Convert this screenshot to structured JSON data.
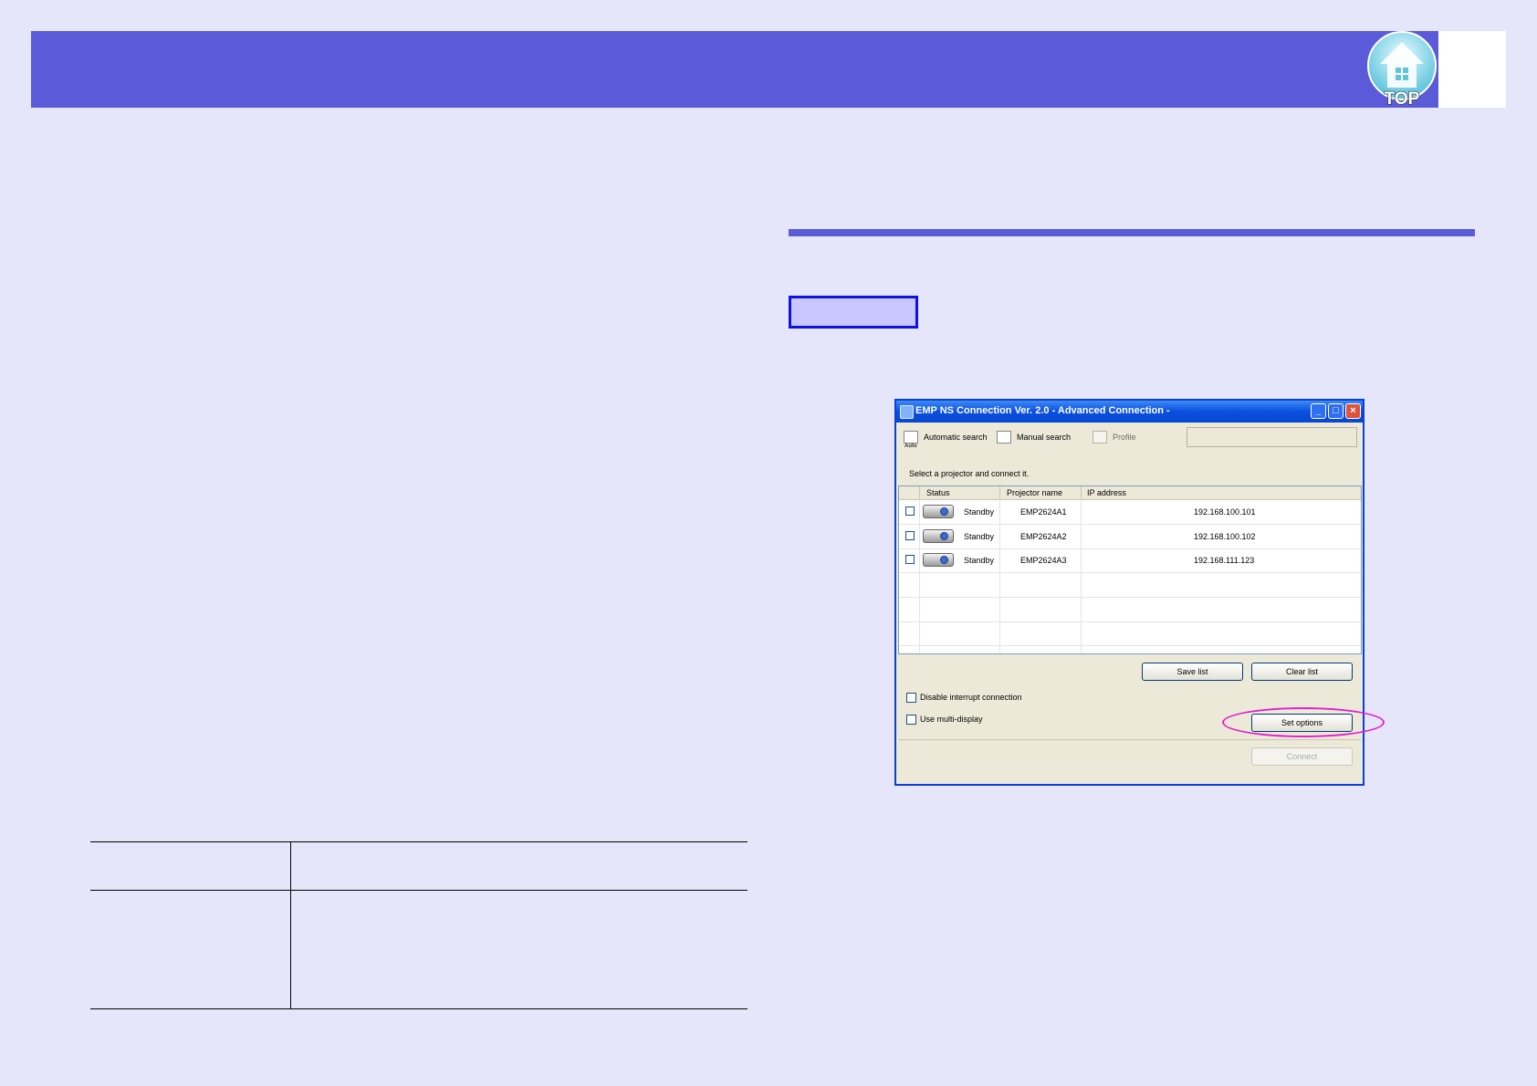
{
  "header": {
    "top_button_label": "TOP"
  },
  "param_table": {
    "header": [
      "",
      ""
    ],
    "rows": [
      [
        "",
        ""
      ]
    ]
  },
  "dialog": {
    "title": "EMP NS Connection Ver. 2.0 - Advanced Connection -",
    "titlebar_buttons": {
      "minimize": "_",
      "maximize": "□",
      "close": "×"
    },
    "toolbar": {
      "auto_icon_text": "Auto",
      "automatic_search": "Automatic search",
      "manual_search": "Manual search",
      "profile": "Profile",
      "profile_arrow": "▾"
    },
    "instruction": "Select a projector and connect it.",
    "columns": [
      "Status",
      "Projector name",
      "IP address"
    ],
    "rows": [
      {
        "status": "Standby",
        "name": "EMP2624A1",
        "ip": "192.168.100.101"
      },
      {
        "status": "Standby",
        "name": "EMP2624A2",
        "ip": "192.168.100.102"
      },
      {
        "status": "Standby",
        "name": "EMP2624A3",
        "ip": "192.168.111.123"
      }
    ],
    "save_list": "Save list",
    "clear_list": "Clear list",
    "disable_interrupt": "Disable interrupt connection",
    "use_multi_display": "Use multi-display",
    "set_options": "Set options",
    "connect": "Connect"
  },
  "colors": {
    "header_band": "#5b5bd9",
    "procedure_box_fill": "#c8c8ff",
    "procedure_box_border": "#1010e0",
    "highlight": "#e020d0"
  }
}
